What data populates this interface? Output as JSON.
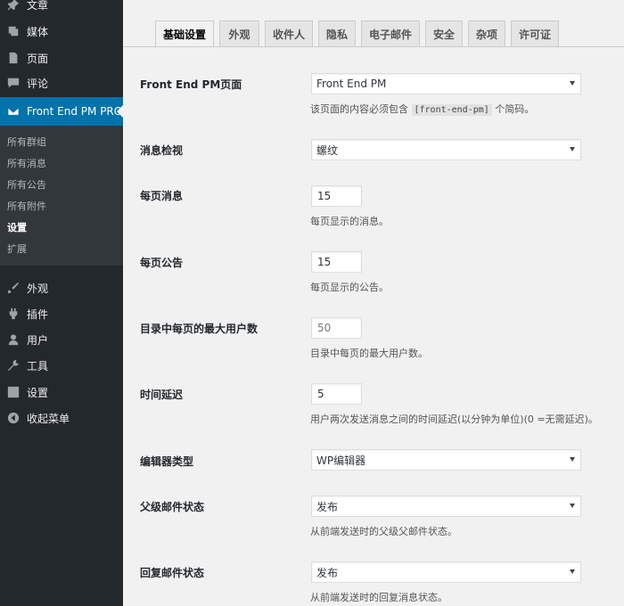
{
  "sidebar": {
    "top_items": [
      {
        "label": "文章",
        "icon": "pin-icon"
      },
      {
        "label": "媒体",
        "icon": "media-icon"
      },
      {
        "label": "页面",
        "icon": "page-icon"
      },
      {
        "label": "评论",
        "icon": "comment-icon"
      }
    ],
    "active_item": {
      "label": "Front End PM PRO",
      "icon": "envelope-icon"
    },
    "submenu": [
      "所有群组",
      "所有消息",
      "所有公告",
      "所有附件",
      "设置",
      "扩展"
    ],
    "submenu_current": "设置",
    "bottom_items": [
      {
        "label": "外观",
        "icon": "brush-icon"
      },
      {
        "label": "插件",
        "icon": "plug-icon"
      },
      {
        "label": "用户",
        "icon": "user-icon"
      },
      {
        "label": "工具",
        "icon": "wrench-icon"
      },
      {
        "label": "设置",
        "icon": "settings-icon"
      },
      {
        "label": "收起菜单",
        "icon": "collapse-icon"
      }
    ]
  },
  "tabs": [
    "基础设置",
    "外观",
    "收件人",
    "隐私",
    "电子邮件",
    "安全",
    "杂项",
    "许可证"
  ],
  "active_tab": "基础设置",
  "settings": [
    {
      "label": "Front End PM页面",
      "type": "select",
      "value": "Front End PM",
      "desc_prefix": "该页面的内容必须包含",
      "desc_code": "[front-end-pm]",
      "desc_suffix": "个简码。"
    },
    {
      "label": "消息检视",
      "type": "select",
      "value": "螺纹"
    },
    {
      "label": "每页消息",
      "type": "number",
      "value": "15",
      "desc": "每页显示的消息。"
    },
    {
      "label": "每页公告",
      "type": "number",
      "value": "15",
      "desc": "每页显示的公告。"
    },
    {
      "label": "目录中每页的最大用户数",
      "type": "number",
      "value": "50",
      "desc": "目录中每页的最大用户数。"
    },
    {
      "label": "时间延迟",
      "type": "number",
      "value": "5",
      "desc": "用户两次发送消息之间的时间延迟(以分钟为单位)(0 =无需延迟)。"
    },
    {
      "label": "编辑器类型",
      "type": "select",
      "value": "WP编辑器"
    },
    {
      "label": "父级邮件状态",
      "type": "select",
      "value": "发布",
      "desc": "从前端发送时的父级父邮件状态。"
    },
    {
      "label": "回复邮件状态",
      "type": "select",
      "value": "发布",
      "desc": "从前端发送时的回复消息状态。"
    }
  ],
  "colors": {
    "sidebar": "#23282d",
    "active": "#0073aa",
    "submenu": "#32373c"
  }
}
